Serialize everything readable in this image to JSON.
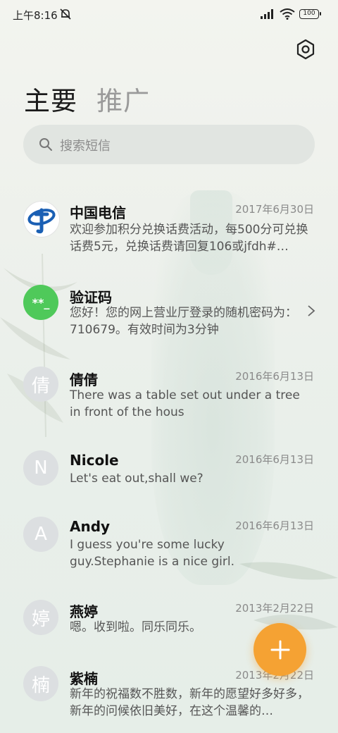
{
  "status_bar": {
    "time": "上午8:16",
    "battery": "100"
  },
  "tabs": [
    {
      "label": "主要",
      "active": true
    },
    {
      "label": "推广",
      "active": false
    }
  ],
  "search": {
    "placeholder": "搜索短信"
  },
  "conversations": [
    {
      "name": "中国电信",
      "date": "2017年6月30日",
      "preview": "欢迎参加积分兑换话费活动，每500分可兑换话费5元，兑换话费请回复106或jfdh#…",
      "avatar": "logo"
    },
    {
      "name": "验证码",
      "date": "",
      "preview": "您好！您的网上营业厅登录的随机密码为：710679。有效时间为3分钟",
      "avatar": "**_"
    },
    {
      "name": "倩倩",
      "date": "2016年6月13日",
      "preview": "There was a table set out under a tree in front of the hous",
      "avatar": "倩"
    },
    {
      "name": "Nicole",
      "date": "2016年6月13日",
      "preview": "Let's eat out,shall we?",
      "avatar": "N"
    },
    {
      "name": "Andy",
      "date": "2016年6月13日",
      "preview": "I guess you're some lucky guy.Stephanie is a nice girl.",
      "avatar": "A"
    },
    {
      "name": "燕婷",
      "date": "2013年2月22日",
      "preview": "嗯。收到啦。同乐同乐。",
      "avatar": "婷"
    },
    {
      "name": "紫楠",
      "date": "2013年2月22日",
      "preview": "新年的祝福数不胜数，新年的愿望好多好多，新年的问候依旧美好，在这个温馨的…",
      "avatar": "楠"
    }
  ],
  "colors": {
    "accent": "#f5a233",
    "verify_avatar": "#4fc95a",
    "telecom_blue": "#1a5fb4"
  }
}
